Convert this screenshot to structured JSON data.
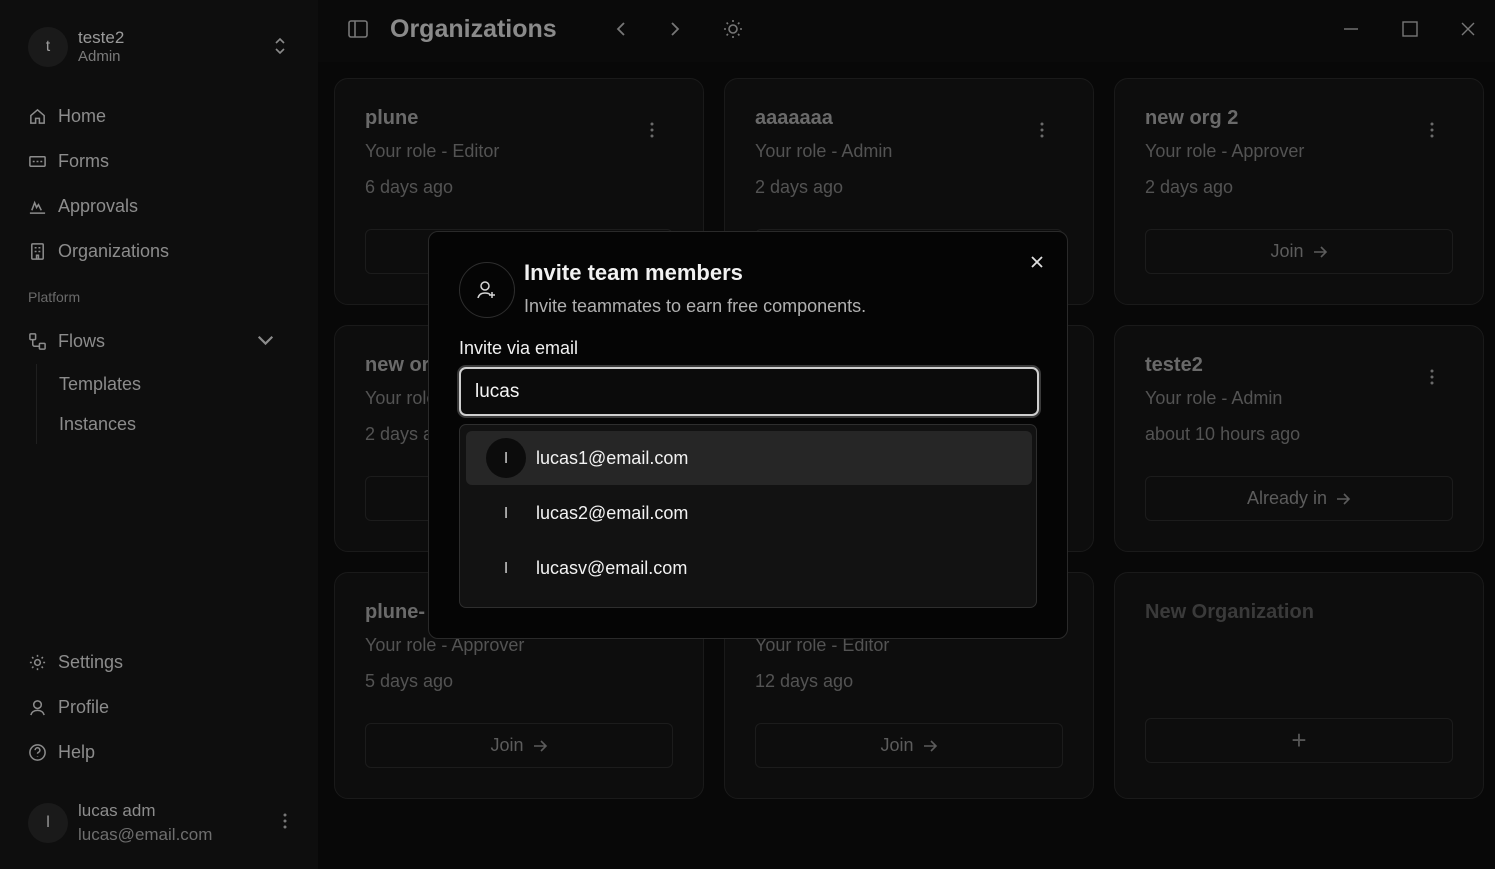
{
  "workspace": {
    "avatar_initial": "t",
    "name": "teste2",
    "role": "Admin"
  },
  "nav": {
    "home": "Home",
    "forms": "Forms",
    "approvals": "Approvals",
    "organizations": "Organizations",
    "platform_label": "Platform",
    "flows": "Flows",
    "templates": "Templates",
    "instances": "Instances",
    "settings": "Settings",
    "profile": "Profile",
    "help": "Help"
  },
  "user": {
    "avatar_initial": "l",
    "name": "lucas adm",
    "email": "lucas@email.com"
  },
  "topbar": {
    "title": "Organizations"
  },
  "cards": [
    {
      "name": "plune",
      "role": "Your role - Editor",
      "time": "6 days ago",
      "action": ""
    },
    {
      "name": "aaaaaaa",
      "role": "Your role - Admin",
      "time": "2 days ago",
      "action": ""
    },
    {
      "name": "new org 2",
      "role": "Your role - Approver",
      "time": "2 days ago",
      "action": "Join"
    },
    {
      "name": "new or",
      "role": "Your role",
      "time": "2 days a",
      "action": ""
    },
    {
      "name": "teste2",
      "role": "Your role - Admin",
      "time": "about 10 hours ago",
      "action": "Already in"
    },
    {
      "name": "plune-",
      "role": "Your role - Approver",
      "time": "5 days ago",
      "action": "Join"
    },
    {
      "name": "",
      "role": "Your role - Editor",
      "time": "12 days ago",
      "action": "Join"
    },
    {
      "name": "New Organization",
      "action": "+"
    }
  ],
  "modal": {
    "title": "Invite team members",
    "description": "Invite teammates to earn free components.",
    "label": "Invite via email",
    "input_value": "lucas",
    "suggestions": [
      {
        "initial": "l",
        "email": "lucas1@email.com"
      },
      {
        "initial": "l",
        "email": "lucas2@email.com"
      },
      {
        "initial": "l",
        "email": "lucasv@email.com"
      }
    ]
  }
}
